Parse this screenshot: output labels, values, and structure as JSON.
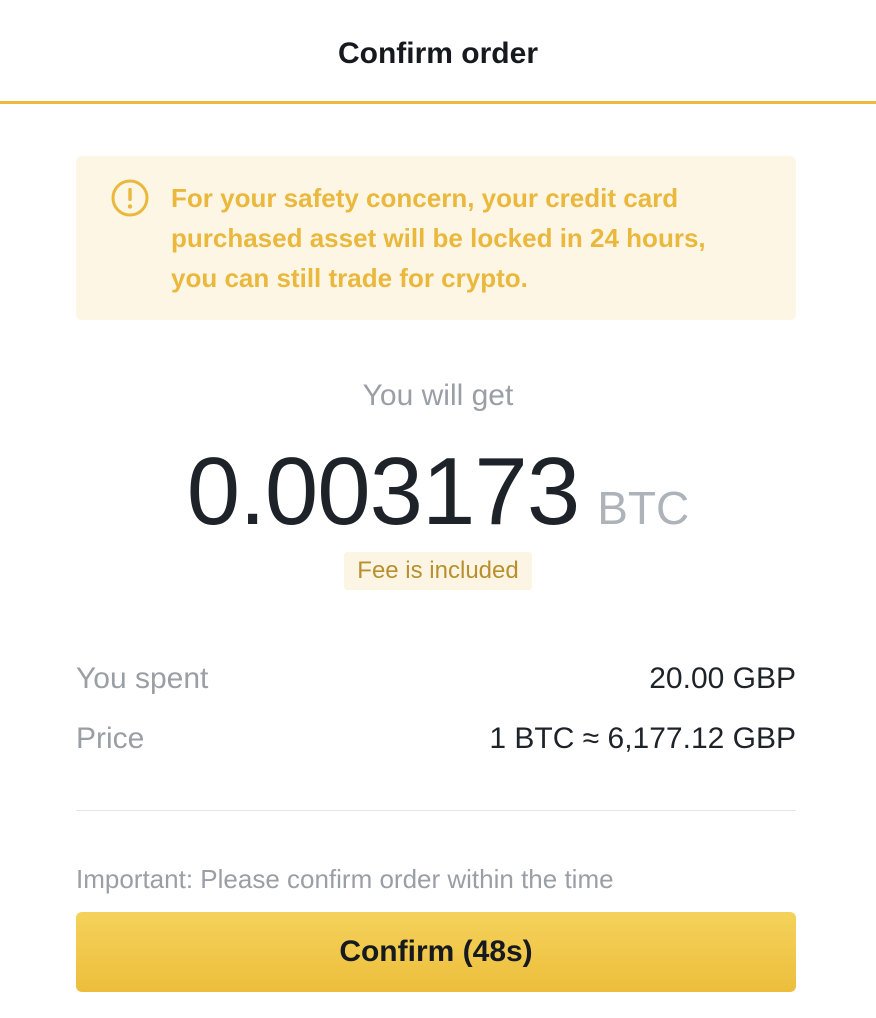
{
  "header": {
    "title": "Confirm order"
  },
  "notice": {
    "icon": "warning-circle-icon",
    "line1": "For your safety concern, your credit card",
    "line2": "purchased asset will be locked in 24 hours,",
    "line3": "you can still trade for crypto.",
    "color": "#E9B83D",
    "background": "#FEF6E5"
  },
  "summary": {
    "get_label": "You will get",
    "amount": "0.003173",
    "unit": "BTC",
    "fee_note": "Fee is included"
  },
  "details": {
    "spent_label": "You spent",
    "spent_value": "20.00 GBP",
    "price_label": "Price",
    "price_value": "1 BTC ≈ 6,177.12 GBP"
  },
  "footer": {
    "important_note": "Important: Please confirm order within the time",
    "confirm_label": "Confirm (48s)",
    "accent_color": "#EDBB3C"
  }
}
